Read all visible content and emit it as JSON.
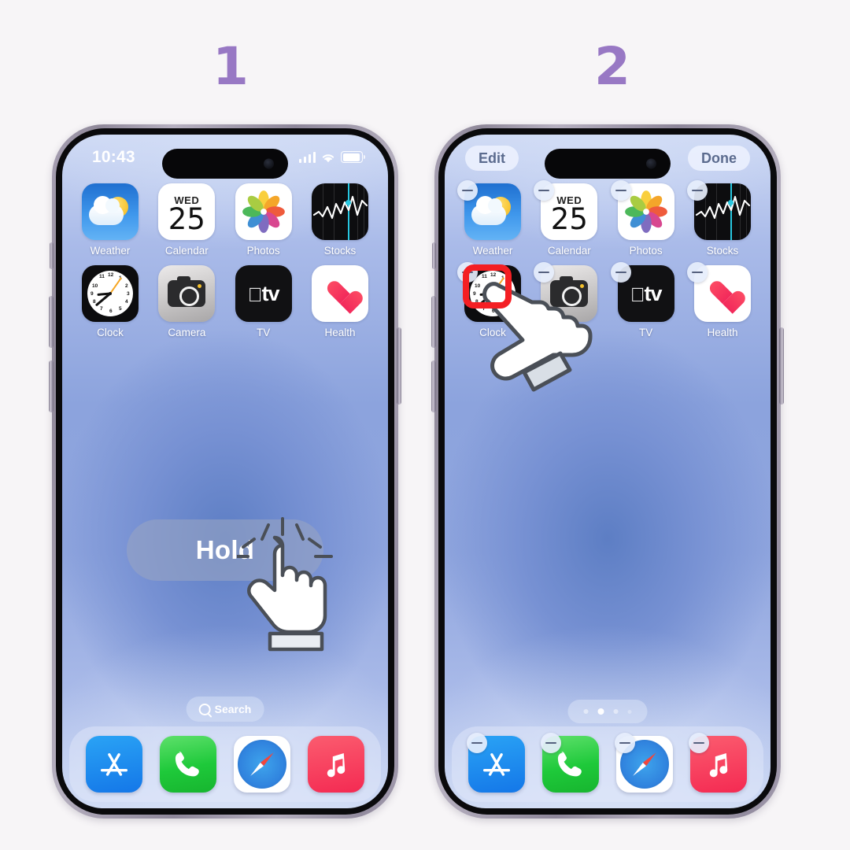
{
  "steps": [
    {
      "number": "1"
    },
    {
      "number": "2"
    }
  ],
  "accent_colors": {
    "step_number": "#9878c4",
    "highlight_box": "#f41f24",
    "phone_band": "#a29bae"
  },
  "phone1": {
    "statusbar": {
      "time": "10:43",
      "signal_icon": "cellular-bars-icon",
      "wifi_icon": "wifi-icon",
      "battery_icon": "battery-icon"
    },
    "apps": [
      [
        {
          "label": "Weather",
          "icon": "weather-icon"
        },
        {
          "label": "Calendar",
          "icon": "calendar-icon",
          "dow": "WED",
          "day": "25"
        },
        {
          "label": "Photos",
          "icon": "photos-icon"
        },
        {
          "label": "Stocks",
          "icon": "stocks-icon"
        }
      ],
      [
        {
          "label": "Clock",
          "icon": "clock-icon"
        },
        {
          "label": "Camera",
          "icon": "camera-icon"
        },
        {
          "label": "TV",
          "icon": "tv-icon"
        },
        {
          "label": "Health",
          "icon": "health-icon"
        }
      ]
    ],
    "search": {
      "label": "Search",
      "icon": "search-icon"
    },
    "dock": [
      {
        "label": "App Store",
        "icon": "app-store-icon"
      },
      {
        "label": "Phone",
        "icon": "phone-icon"
      },
      {
        "label": "Safari",
        "icon": "safari-icon"
      },
      {
        "label": "Music",
        "icon": "music-icon"
      }
    ],
    "overlay": {
      "hold_label": "Hold",
      "cursor": "tap-hand-cursor"
    }
  },
  "phone2": {
    "toolbar": {
      "edit_label": "Edit",
      "done_label": "Done"
    },
    "apps": [
      [
        {
          "label": "Weather",
          "icon": "weather-icon",
          "badge": "remove-minus-badge"
        },
        {
          "label": "Calendar",
          "icon": "calendar-icon",
          "dow": "WED",
          "day": "25",
          "badge": "remove-minus-badge"
        },
        {
          "label": "Photos",
          "icon": "photos-icon",
          "badge": "remove-minus-badge"
        },
        {
          "label": "Stocks",
          "icon": "stocks-icon",
          "badge": "remove-minus-badge"
        }
      ],
      [
        {
          "label": "Clock",
          "icon": "clock-icon",
          "badge": "remove-minus-badge"
        },
        {
          "label": "Camera",
          "icon": "camera-icon",
          "badge": "remove-minus-badge"
        },
        {
          "label": "TV",
          "icon": "tv-icon",
          "badge": "remove-minus-badge"
        },
        {
          "label": "Health",
          "icon": "health-icon",
          "badge": "remove-minus-badge"
        }
      ]
    ],
    "page_dots": {
      "count": 4,
      "active_index": 1
    },
    "dock": [
      {
        "label": "App Store",
        "icon": "app-store-icon",
        "badge": "remove-minus-badge"
      },
      {
        "label": "Phone",
        "icon": "phone-icon",
        "badge": "remove-minus-badge"
      },
      {
        "label": "Safari",
        "icon": "safari-icon",
        "badge": "remove-minus-badge"
      },
      {
        "label": "Music",
        "icon": "music-icon",
        "badge": "remove-minus-badge"
      }
    ],
    "overlay": {
      "cursor": "flat-hand-cursor",
      "highlight": "red-highlight-box"
    }
  }
}
